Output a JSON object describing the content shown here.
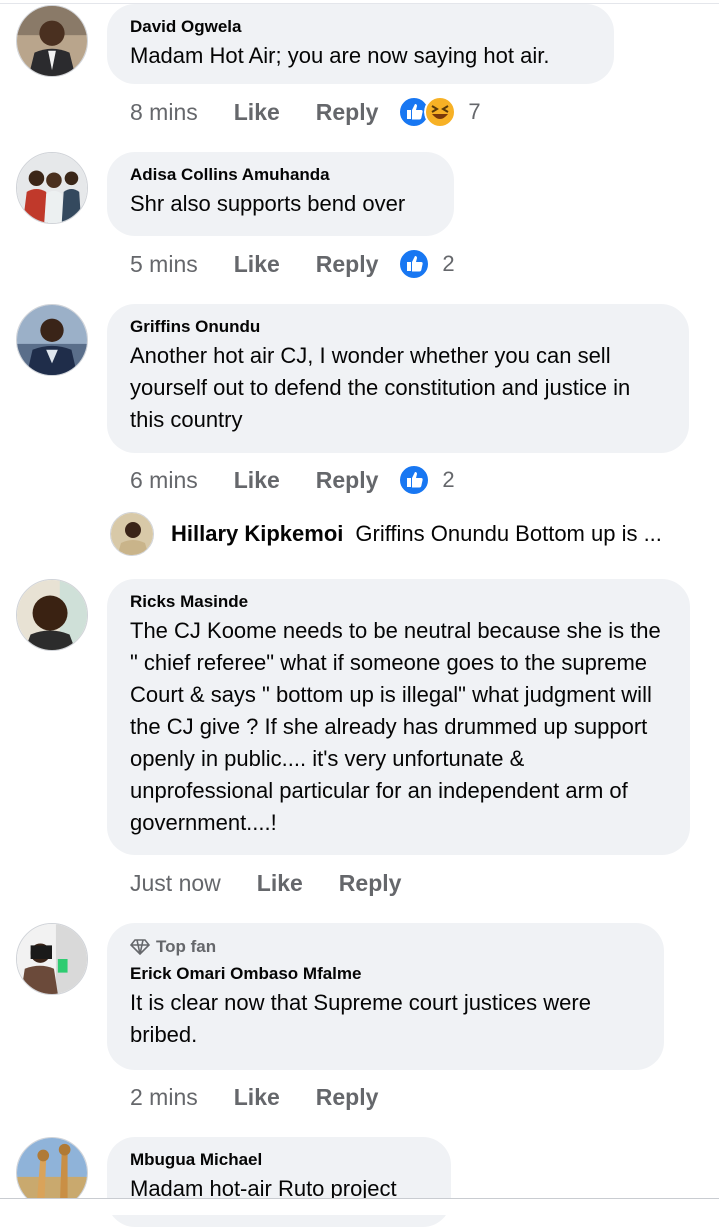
{
  "comments": [
    {
      "author": "David Ogwela",
      "text": "Madam Hot Air; you are now saying hot air.",
      "time": "8 mins",
      "like": "Like",
      "reply": "Reply",
      "reaction_count": "7",
      "reactions": [
        "like",
        "haha"
      ]
    },
    {
      "author": "Adisa Collins Amuhanda",
      "text": "Shr also supports bend over",
      "time": "5 mins",
      "like": "Like",
      "reply": "Reply",
      "reaction_count": "2",
      "reactions": [
        "like"
      ]
    },
    {
      "author": "Griffins Onundu",
      "text": "Another hot air CJ, I wonder whether you can sell yourself out to defend the constitution and justice in this country",
      "time": "6 mins",
      "like": "Like",
      "reply": "Reply",
      "reaction_count": "2",
      "reactions": [
        "like"
      ]
    },
    {
      "author": "Ricks Masinde",
      "text": "The CJ Koome needs to be neutral because she is the \" chief referee\" what if someone goes to the supreme Court & says \" bottom up is illegal\" what judgment will the CJ give ? If she already has drummed up support openly in public.... it's very unfortunate & unprofessional particular for an independent arm of government....!",
      "time": "Just now",
      "like": "Like",
      "reply": "Reply"
    },
    {
      "badge": "Top fan",
      "author": "Erick Omari Ombaso Mfalme",
      "text": "It is clear now that Supreme court justices were bribed.",
      "time": "2 mins",
      "like": "Like",
      "reply": "Reply"
    },
    {
      "author": "Mbugua Michael",
      "text": "Madam hot-air Ruto project"
    }
  ],
  "reply_preview": {
    "author": "Hillary Kipkemoi",
    "text": "Griffins Onundu Bottom up is ..."
  },
  "colors": {
    "like_blue": "#1877f2",
    "haha_yellow": "#f7b125",
    "bubble": "#f0f2f5",
    "meta_gray": "#65676b"
  }
}
